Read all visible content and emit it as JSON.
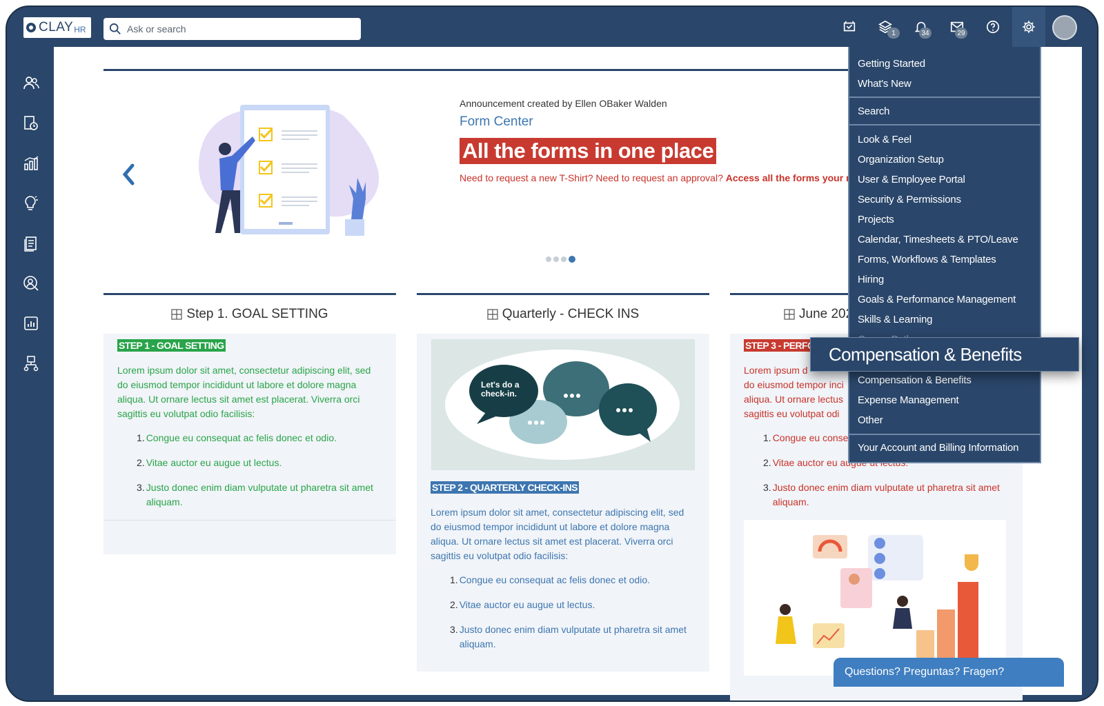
{
  "app": {
    "logo_text": "CLAY",
    "logo_suffix": "HR",
    "search_placeholder": "Ask or search"
  },
  "topbar": {
    "icons": [
      {
        "name": "inbox-check-icon",
        "badge": ""
      },
      {
        "name": "layers-icon",
        "badge": "1"
      },
      {
        "name": "bell-icon",
        "badge": "34"
      },
      {
        "name": "mail-icon",
        "badge": "29"
      },
      {
        "name": "help-icon",
        "badge": ""
      },
      {
        "name": "gear-icon",
        "badge": ""
      }
    ]
  },
  "sidebar": {
    "icons": [
      "people-icon",
      "clock-doc-icon",
      "chart-icon",
      "lightbulb-icon",
      "documents-icon",
      "search-person-icon",
      "report-icon",
      "org-chart-icon"
    ]
  },
  "announcement": {
    "created_by": "Announcement created by Ellen OBaker Walden",
    "title": "Form Center",
    "headline": "All the forms in one place",
    "desc_lead": "Need to request a new T-Shirt? Need to request an approval? ",
    "desc_bold": "Access all the forms your ne",
    "dots": [
      false,
      false,
      false,
      true
    ]
  },
  "cards": [
    {
      "title": "Step 1. GOAL SETTING",
      "tag": "STEP 1 - GOAL SETTING",
      "text": "Lorem ipsum dolor sit amet, consectetur adipiscing elit, sed do eiusmod tempor incididunt ut labore et dolore magna aliqua. Ut ornare lectus sit amet est placerat. Viverra orci sagittis eu volutpat odio facilisis:",
      "list": [
        "Congue eu consequat ac felis donec et odio.",
        "Vitae auctor eu augue ut lectus.",
        "Justo donec enim diam vulputate ut pharetra sit amet aliquam."
      ]
    },
    {
      "title": "Quarterly - CHECK INS",
      "bubble_text": "Let's do a check-in.",
      "tag": "STEP 2 - QUARTERLY CHECK-INS",
      "text": "Lorem ipsum dolor sit amet, consectetur adipiscing elit, sed do eiusmod tempor incididunt ut labore et dolore magna aliqua. Ut ornare lectus sit amet est placerat. Viverra orci sagittis eu volutpat odio facilisis:",
      "list": [
        "Congue eu consequat ac felis donec et odio.",
        "Vitae auctor eu augue ut lectus.",
        "Justo donec enim diam vulputate ut pharetra sit amet aliquam."
      ]
    },
    {
      "title": "June 202",
      "tag": "STEP 3 - PERFC",
      "text": "Lorem ipsum d",
      "text2": "do eiusmod tempor inci",
      "text3": "aliqua. Ut ornare lectus",
      "text4": "sagittis eu volutpat odi",
      "list": [
        "Congue eu conse",
        "Vitae auctor eu augue ut lectus.",
        "Justo donec enim diam vulputate ut pharetra sit amet aliquam."
      ]
    }
  ],
  "settings_menu": {
    "groups": [
      [
        "Getting Started",
        "What's New"
      ],
      [
        "Search"
      ],
      [
        "Look & Feel",
        "Organization Setup",
        "User & Employee Portal",
        "Security & Permissions",
        "Projects",
        "Calendar, Timesheets & PTO/Leave",
        "Forms, Workflows & Templates",
        "Hiring",
        "Goals & Performance Management",
        "Skills & Learning",
        "Career Pathways"
      ],
      [
        "Compensation & Benefits",
        "Expense Management",
        "Other"
      ],
      [
        "Your Account and Billing Information"
      ]
    ],
    "highlighted": "Compensation & Benefits"
  },
  "help_button": "Questions? Preguntas? Fragen?",
  "colors": {
    "navy": "#2a466a",
    "accent_red": "#c83a30",
    "green": "#29a44a",
    "blue": "#3d76b0"
  }
}
